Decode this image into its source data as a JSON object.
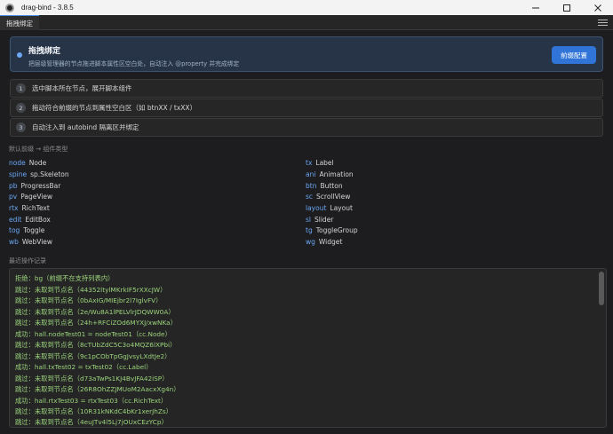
{
  "window": {
    "title": "drag-bind - 3.8.5"
  },
  "tab": {
    "label": "拖拽绑定"
  },
  "hero": {
    "title": "拖拽绑定",
    "subtitle": "把层级管理器的节点拖进脚本属性区空白处，自动注入 @property 并完成绑定",
    "button_label": "前缀配置"
  },
  "steps": [
    {
      "num": "1",
      "text": "选中脚本所在节点，展开脚本组件"
    },
    {
      "num": "2",
      "text": "拖动符合前缀的节点到属性空白区（如 btnXX / txXX）"
    },
    {
      "num": "3",
      "text": "自动注入到 autobind 隔离区并绑定"
    }
  ],
  "mapping": {
    "label": "默认前缀 → 组件类型",
    "left": [
      {
        "prefix": "node",
        "type": "Node"
      },
      {
        "prefix": "spine",
        "type": "sp.Skeleton"
      },
      {
        "prefix": "pb",
        "type": "ProgressBar"
      },
      {
        "prefix": "pv",
        "type": "PageView"
      },
      {
        "prefix": "rtx",
        "type": "RichText"
      },
      {
        "prefix": "edit",
        "type": "EditBox"
      },
      {
        "prefix": "tog",
        "type": "Toggle"
      },
      {
        "prefix": "wb",
        "type": "WebView"
      }
    ],
    "right": [
      {
        "prefix": "tx",
        "type": "Label"
      },
      {
        "prefix": "ani",
        "type": "Animation"
      },
      {
        "prefix": "btn",
        "type": "Button"
      },
      {
        "prefix": "sc",
        "type": "ScrollView"
      },
      {
        "prefix": "layout",
        "type": "Layout"
      },
      {
        "prefix": "sl",
        "type": "Slider"
      },
      {
        "prefix": "tg",
        "type": "ToggleGroup"
      },
      {
        "prefix": "wg",
        "type": "Widget"
      }
    ]
  },
  "log": {
    "label": "最近操作记录",
    "lines": [
      "拒绝：bg（前缀不在支持列表内）",
      "跳过：未取到节点名（44352ltylMKrkIF5rXXcJW）",
      "跳过：未取到节点名（0bAxIG/MIEjbr2l7IglvFV）",
      "跳过：未取到节点名（2e/Wu8A1lPELVlrJDQWW0A）",
      "跳过：未取到节点名（24h+RFCiZOd6MYXJ/xwNKa）",
      "成功：hall.nodeTest01 = nodeTest01（cc.Node）",
      "跳过：未取到节点名（8cTUbZdC5C3o4MQZ6lXPbi）",
      "跳过：未取到节点名（9c1pCObTpGgJvsyLXdtJe2）",
      "成功：hall.txTest02 = txTest02（cc.Label）",
      "跳过：未取到节点名（d73aTwPs1KJ4BvJFA42iSP）",
      "跳过：未取到节点名（26R8OhZZJMUoM2AacxXg4n）",
      "成功：hall.rtxTest03 = rtxTest03（cc.RichText）",
      "跳过：未取到节点名（10R31kNKdC4bKr1xerJhZs）",
      "跳过：未取到节点名（4euJTv4l5Lj7jOUxCEzYCp）"
    ]
  },
  "colors": {
    "accent": "#2f74d6",
    "prefix": "#6aa7f5",
    "log_text": "#9bd47b",
    "background": "#1d1d1f"
  }
}
